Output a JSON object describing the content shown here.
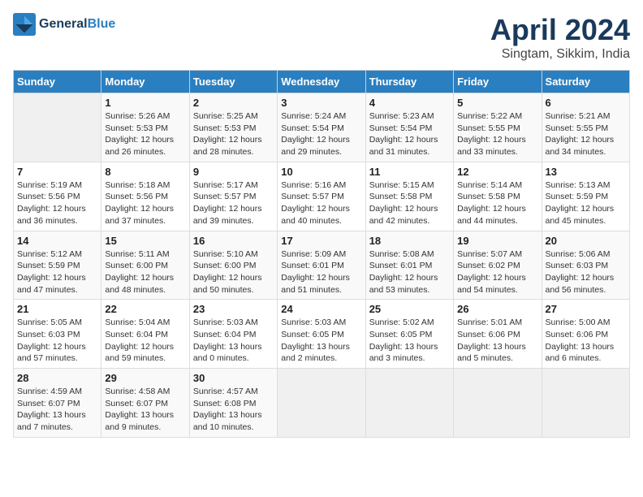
{
  "logo": {
    "line1": "General",
    "line2": "Blue"
  },
  "title": "April 2024",
  "subtitle": "Singtam, Sikkim, India",
  "headers": [
    "Sunday",
    "Monday",
    "Tuesday",
    "Wednesday",
    "Thursday",
    "Friday",
    "Saturday"
  ],
  "weeks": [
    [
      {
        "num": "",
        "info": ""
      },
      {
        "num": "1",
        "info": "Sunrise: 5:26 AM\nSunset: 5:53 PM\nDaylight: 12 hours\nand 26 minutes."
      },
      {
        "num": "2",
        "info": "Sunrise: 5:25 AM\nSunset: 5:53 PM\nDaylight: 12 hours\nand 28 minutes."
      },
      {
        "num": "3",
        "info": "Sunrise: 5:24 AM\nSunset: 5:54 PM\nDaylight: 12 hours\nand 29 minutes."
      },
      {
        "num": "4",
        "info": "Sunrise: 5:23 AM\nSunset: 5:54 PM\nDaylight: 12 hours\nand 31 minutes."
      },
      {
        "num": "5",
        "info": "Sunrise: 5:22 AM\nSunset: 5:55 PM\nDaylight: 12 hours\nand 33 minutes."
      },
      {
        "num": "6",
        "info": "Sunrise: 5:21 AM\nSunset: 5:55 PM\nDaylight: 12 hours\nand 34 minutes."
      }
    ],
    [
      {
        "num": "7",
        "info": "Sunrise: 5:19 AM\nSunset: 5:56 PM\nDaylight: 12 hours\nand 36 minutes."
      },
      {
        "num": "8",
        "info": "Sunrise: 5:18 AM\nSunset: 5:56 PM\nDaylight: 12 hours\nand 37 minutes."
      },
      {
        "num": "9",
        "info": "Sunrise: 5:17 AM\nSunset: 5:57 PM\nDaylight: 12 hours\nand 39 minutes."
      },
      {
        "num": "10",
        "info": "Sunrise: 5:16 AM\nSunset: 5:57 PM\nDaylight: 12 hours\nand 40 minutes."
      },
      {
        "num": "11",
        "info": "Sunrise: 5:15 AM\nSunset: 5:58 PM\nDaylight: 12 hours\nand 42 minutes."
      },
      {
        "num": "12",
        "info": "Sunrise: 5:14 AM\nSunset: 5:58 PM\nDaylight: 12 hours\nand 44 minutes."
      },
      {
        "num": "13",
        "info": "Sunrise: 5:13 AM\nSunset: 5:59 PM\nDaylight: 12 hours\nand 45 minutes."
      }
    ],
    [
      {
        "num": "14",
        "info": "Sunrise: 5:12 AM\nSunset: 5:59 PM\nDaylight: 12 hours\nand 47 minutes."
      },
      {
        "num": "15",
        "info": "Sunrise: 5:11 AM\nSunset: 6:00 PM\nDaylight: 12 hours\nand 48 minutes."
      },
      {
        "num": "16",
        "info": "Sunrise: 5:10 AM\nSunset: 6:00 PM\nDaylight: 12 hours\nand 50 minutes."
      },
      {
        "num": "17",
        "info": "Sunrise: 5:09 AM\nSunset: 6:01 PM\nDaylight: 12 hours\nand 51 minutes."
      },
      {
        "num": "18",
        "info": "Sunrise: 5:08 AM\nSunset: 6:01 PM\nDaylight: 12 hours\nand 53 minutes."
      },
      {
        "num": "19",
        "info": "Sunrise: 5:07 AM\nSunset: 6:02 PM\nDaylight: 12 hours\nand 54 minutes."
      },
      {
        "num": "20",
        "info": "Sunrise: 5:06 AM\nSunset: 6:03 PM\nDaylight: 12 hours\nand 56 minutes."
      }
    ],
    [
      {
        "num": "21",
        "info": "Sunrise: 5:05 AM\nSunset: 6:03 PM\nDaylight: 12 hours\nand 57 minutes."
      },
      {
        "num": "22",
        "info": "Sunrise: 5:04 AM\nSunset: 6:04 PM\nDaylight: 12 hours\nand 59 minutes."
      },
      {
        "num": "23",
        "info": "Sunrise: 5:03 AM\nSunset: 6:04 PM\nDaylight: 13 hours\nand 0 minutes."
      },
      {
        "num": "24",
        "info": "Sunrise: 5:03 AM\nSunset: 6:05 PM\nDaylight: 13 hours\nand 2 minutes."
      },
      {
        "num": "25",
        "info": "Sunrise: 5:02 AM\nSunset: 6:05 PM\nDaylight: 13 hours\nand 3 minutes."
      },
      {
        "num": "26",
        "info": "Sunrise: 5:01 AM\nSunset: 6:06 PM\nDaylight: 13 hours\nand 5 minutes."
      },
      {
        "num": "27",
        "info": "Sunrise: 5:00 AM\nSunset: 6:06 PM\nDaylight: 13 hours\nand 6 minutes."
      }
    ],
    [
      {
        "num": "28",
        "info": "Sunrise: 4:59 AM\nSunset: 6:07 PM\nDaylight: 13 hours\nand 7 minutes."
      },
      {
        "num": "29",
        "info": "Sunrise: 4:58 AM\nSunset: 6:07 PM\nDaylight: 13 hours\nand 9 minutes."
      },
      {
        "num": "30",
        "info": "Sunrise: 4:57 AM\nSunset: 6:08 PM\nDaylight: 13 hours\nand 10 minutes."
      },
      {
        "num": "",
        "info": ""
      },
      {
        "num": "",
        "info": ""
      },
      {
        "num": "",
        "info": ""
      },
      {
        "num": "",
        "info": ""
      }
    ]
  ]
}
